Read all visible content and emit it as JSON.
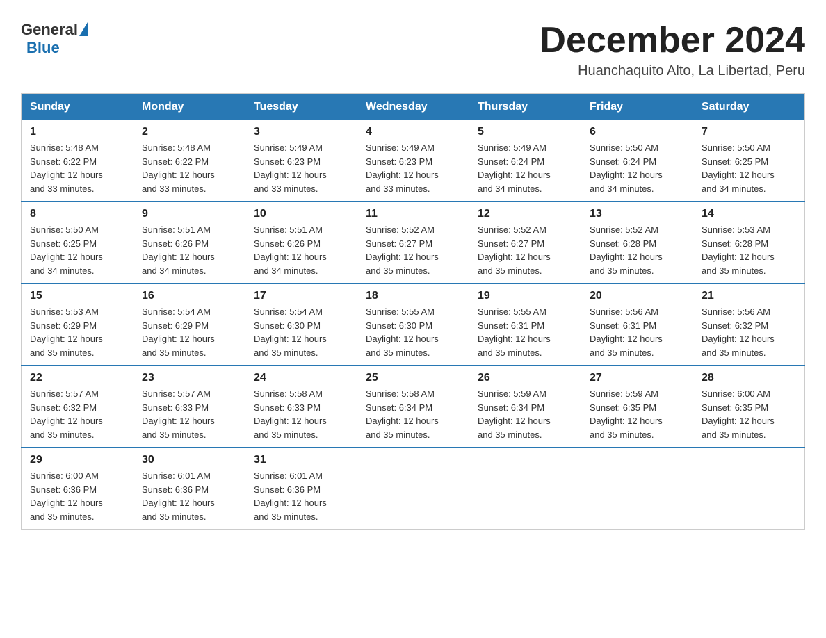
{
  "header": {
    "logo_general": "General",
    "logo_blue": "Blue",
    "month_title": "December 2024",
    "location": "Huanchaquito Alto, La Libertad, Peru"
  },
  "days_of_week": [
    "Sunday",
    "Monday",
    "Tuesday",
    "Wednesday",
    "Thursday",
    "Friday",
    "Saturday"
  ],
  "weeks": [
    [
      {
        "day": "1",
        "sunrise": "5:48 AM",
        "sunset": "6:22 PM",
        "daylight": "12 hours and 33 minutes."
      },
      {
        "day": "2",
        "sunrise": "5:48 AM",
        "sunset": "6:22 PM",
        "daylight": "12 hours and 33 minutes."
      },
      {
        "day": "3",
        "sunrise": "5:49 AM",
        "sunset": "6:23 PM",
        "daylight": "12 hours and 33 minutes."
      },
      {
        "day": "4",
        "sunrise": "5:49 AM",
        "sunset": "6:23 PM",
        "daylight": "12 hours and 33 minutes."
      },
      {
        "day": "5",
        "sunrise": "5:49 AM",
        "sunset": "6:24 PM",
        "daylight": "12 hours and 34 minutes."
      },
      {
        "day": "6",
        "sunrise": "5:50 AM",
        "sunset": "6:24 PM",
        "daylight": "12 hours and 34 minutes."
      },
      {
        "day": "7",
        "sunrise": "5:50 AM",
        "sunset": "6:25 PM",
        "daylight": "12 hours and 34 minutes."
      }
    ],
    [
      {
        "day": "8",
        "sunrise": "5:50 AM",
        "sunset": "6:25 PM",
        "daylight": "12 hours and 34 minutes."
      },
      {
        "day": "9",
        "sunrise": "5:51 AM",
        "sunset": "6:26 PM",
        "daylight": "12 hours and 34 minutes."
      },
      {
        "day": "10",
        "sunrise": "5:51 AM",
        "sunset": "6:26 PM",
        "daylight": "12 hours and 34 minutes."
      },
      {
        "day": "11",
        "sunrise": "5:52 AM",
        "sunset": "6:27 PM",
        "daylight": "12 hours and 35 minutes."
      },
      {
        "day": "12",
        "sunrise": "5:52 AM",
        "sunset": "6:27 PM",
        "daylight": "12 hours and 35 minutes."
      },
      {
        "day": "13",
        "sunrise": "5:52 AM",
        "sunset": "6:28 PM",
        "daylight": "12 hours and 35 minutes."
      },
      {
        "day": "14",
        "sunrise": "5:53 AM",
        "sunset": "6:28 PM",
        "daylight": "12 hours and 35 minutes."
      }
    ],
    [
      {
        "day": "15",
        "sunrise": "5:53 AM",
        "sunset": "6:29 PM",
        "daylight": "12 hours and 35 minutes."
      },
      {
        "day": "16",
        "sunrise": "5:54 AM",
        "sunset": "6:29 PM",
        "daylight": "12 hours and 35 minutes."
      },
      {
        "day": "17",
        "sunrise": "5:54 AM",
        "sunset": "6:30 PM",
        "daylight": "12 hours and 35 minutes."
      },
      {
        "day": "18",
        "sunrise": "5:55 AM",
        "sunset": "6:30 PM",
        "daylight": "12 hours and 35 minutes."
      },
      {
        "day": "19",
        "sunrise": "5:55 AM",
        "sunset": "6:31 PM",
        "daylight": "12 hours and 35 minutes."
      },
      {
        "day": "20",
        "sunrise": "5:56 AM",
        "sunset": "6:31 PM",
        "daylight": "12 hours and 35 minutes."
      },
      {
        "day": "21",
        "sunrise": "5:56 AM",
        "sunset": "6:32 PM",
        "daylight": "12 hours and 35 minutes."
      }
    ],
    [
      {
        "day": "22",
        "sunrise": "5:57 AM",
        "sunset": "6:32 PM",
        "daylight": "12 hours and 35 minutes."
      },
      {
        "day": "23",
        "sunrise": "5:57 AM",
        "sunset": "6:33 PM",
        "daylight": "12 hours and 35 minutes."
      },
      {
        "day": "24",
        "sunrise": "5:58 AM",
        "sunset": "6:33 PM",
        "daylight": "12 hours and 35 minutes."
      },
      {
        "day": "25",
        "sunrise": "5:58 AM",
        "sunset": "6:34 PM",
        "daylight": "12 hours and 35 minutes."
      },
      {
        "day": "26",
        "sunrise": "5:59 AM",
        "sunset": "6:34 PM",
        "daylight": "12 hours and 35 minutes."
      },
      {
        "day": "27",
        "sunrise": "5:59 AM",
        "sunset": "6:35 PM",
        "daylight": "12 hours and 35 minutes."
      },
      {
        "day": "28",
        "sunrise": "6:00 AM",
        "sunset": "6:35 PM",
        "daylight": "12 hours and 35 minutes."
      }
    ],
    [
      {
        "day": "29",
        "sunrise": "6:00 AM",
        "sunset": "6:36 PM",
        "daylight": "12 hours and 35 minutes."
      },
      {
        "day": "30",
        "sunrise": "6:01 AM",
        "sunset": "6:36 PM",
        "daylight": "12 hours and 35 minutes."
      },
      {
        "day": "31",
        "sunrise": "6:01 AM",
        "sunset": "6:36 PM",
        "daylight": "12 hours and 35 minutes."
      },
      null,
      null,
      null,
      null
    ]
  ],
  "labels": {
    "sunrise": "Sunrise:",
    "sunset": "Sunset:",
    "daylight": "Daylight:"
  }
}
